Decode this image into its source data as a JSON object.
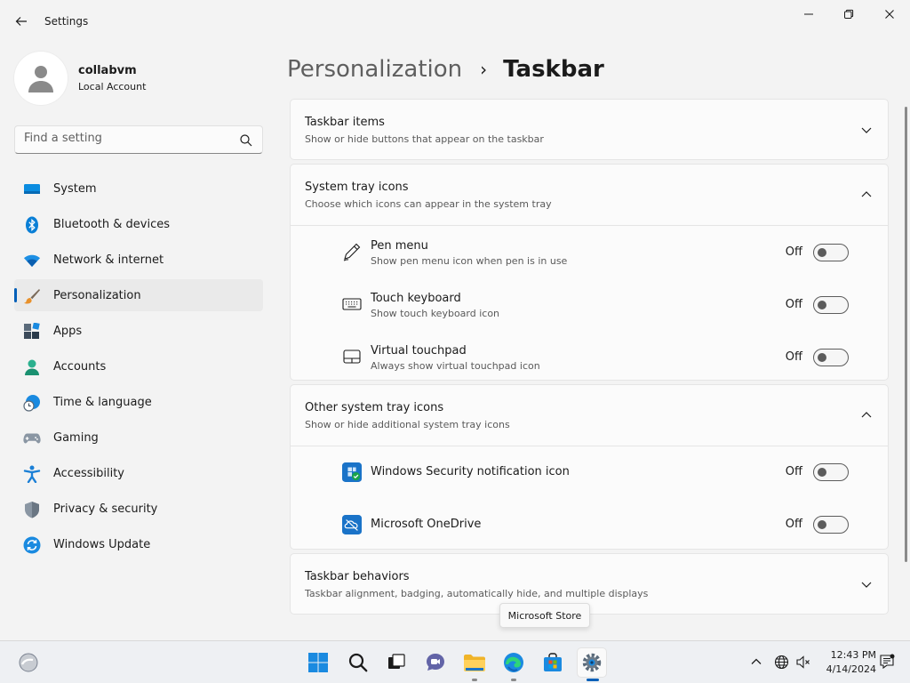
{
  "window": {
    "title": "Settings"
  },
  "profile": {
    "name": "collabvm",
    "account_type": "Local Account"
  },
  "search": {
    "placeholder": "Find a setting"
  },
  "sidebar": {
    "items": [
      {
        "label": "System",
        "icon": "monitor-icon"
      },
      {
        "label": "Bluetooth & devices",
        "icon": "bluetooth-icon"
      },
      {
        "label": "Network & internet",
        "icon": "wifi-icon"
      },
      {
        "label": "Personalization",
        "icon": "paintbrush-icon",
        "selected": true
      },
      {
        "label": "Apps",
        "icon": "apps-icon"
      },
      {
        "label": "Accounts",
        "icon": "person-icon"
      },
      {
        "label": "Time & language",
        "icon": "globe-clock-icon"
      },
      {
        "label": "Gaming",
        "icon": "gamepad-icon"
      },
      {
        "label": "Accessibility",
        "icon": "accessibility-icon"
      },
      {
        "label": "Privacy & security",
        "icon": "shield-icon"
      },
      {
        "label": "Windows Update",
        "icon": "update-icon"
      }
    ]
  },
  "breadcrumb": {
    "parent": "Personalization",
    "separator": "›",
    "current": "Taskbar"
  },
  "sections": {
    "taskbar_items": {
      "title": "Taskbar items",
      "subtitle": "Show or hide buttons that appear on the taskbar"
    },
    "system_tray": {
      "title": "System tray icons",
      "subtitle": "Choose which icons can appear in the system tray",
      "rows": [
        {
          "title": "Pen menu",
          "subtitle": "Show pen menu icon when pen is in use",
          "state": "Off",
          "icon": "pen-icon"
        },
        {
          "title": "Touch keyboard",
          "subtitle": "Show touch keyboard icon",
          "state": "Off",
          "icon": "keyboard-icon"
        },
        {
          "title": "Virtual touchpad",
          "subtitle": "Always show virtual touchpad icon",
          "state": "Off",
          "icon": "touchpad-icon"
        }
      ]
    },
    "other_tray": {
      "title": "Other system tray icons",
      "subtitle": "Show or hide additional system tray icons",
      "rows": [
        {
          "title": "Windows Security notification icon",
          "state": "Off",
          "icon": "windows-security-icon"
        },
        {
          "title": "Microsoft OneDrive",
          "state": "Off",
          "icon": "onedrive-icon"
        }
      ]
    },
    "behaviors": {
      "title": "Taskbar behaviors",
      "subtitle": "Taskbar alignment, badging, automatically hide, and multiple displays"
    }
  },
  "tooltip": {
    "text": "Microsoft Store"
  },
  "taskbar": {
    "time": "12:43 PM",
    "date": "4/14/2024"
  },
  "colors": {
    "accent": "#005fb8",
    "background": "#f3f3f3",
    "card": "#fbfbfb"
  }
}
